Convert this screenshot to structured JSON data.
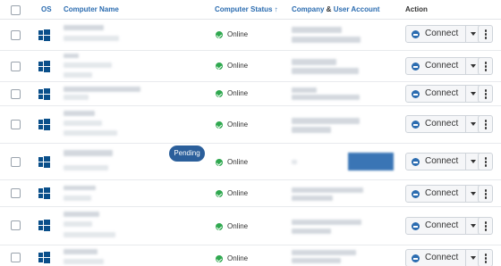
{
  "header": {
    "os": "OS",
    "computer_name": "Computer Name",
    "computer_status": "Computer Status ↑",
    "company": "Company",
    "company_amp": " & ",
    "user_account": "User Account",
    "action": "Action"
  },
  "rows": [
    {
      "status": "Online",
      "connect_label": "Connect"
    },
    {
      "status": "Online",
      "connect_label": "Connect"
    },
    {
      "status": "Online",
      "connect_label": "Connect"
    },
    {
      "status": "Online",
      "connect_label": "Connect"
    },
    {
      "status": "Online",
      "connect_label": "Connect",
      "badge": "Pending"
    },
    {
      "status": "Online",
      "connect_label": "Connect"
    },
    {
      "status": "Online",
      "connect_label": "Connect"
    },
    {
      "status": "Online",
      "connect_label": "Connect"
    }
  ],
  "colors": {
    "accent": "#2b6cb0",
    "online": "#2fa84f",
    "windows": "#0a4f8a",
    "pending": "#2b5f9b"
  },
  "icons": {
    "os": "windows-icon",
    "status": "check-circle-icon",
    "connect": "connect-icon",
    "menu": "more-vertical-icon"
  }
}
